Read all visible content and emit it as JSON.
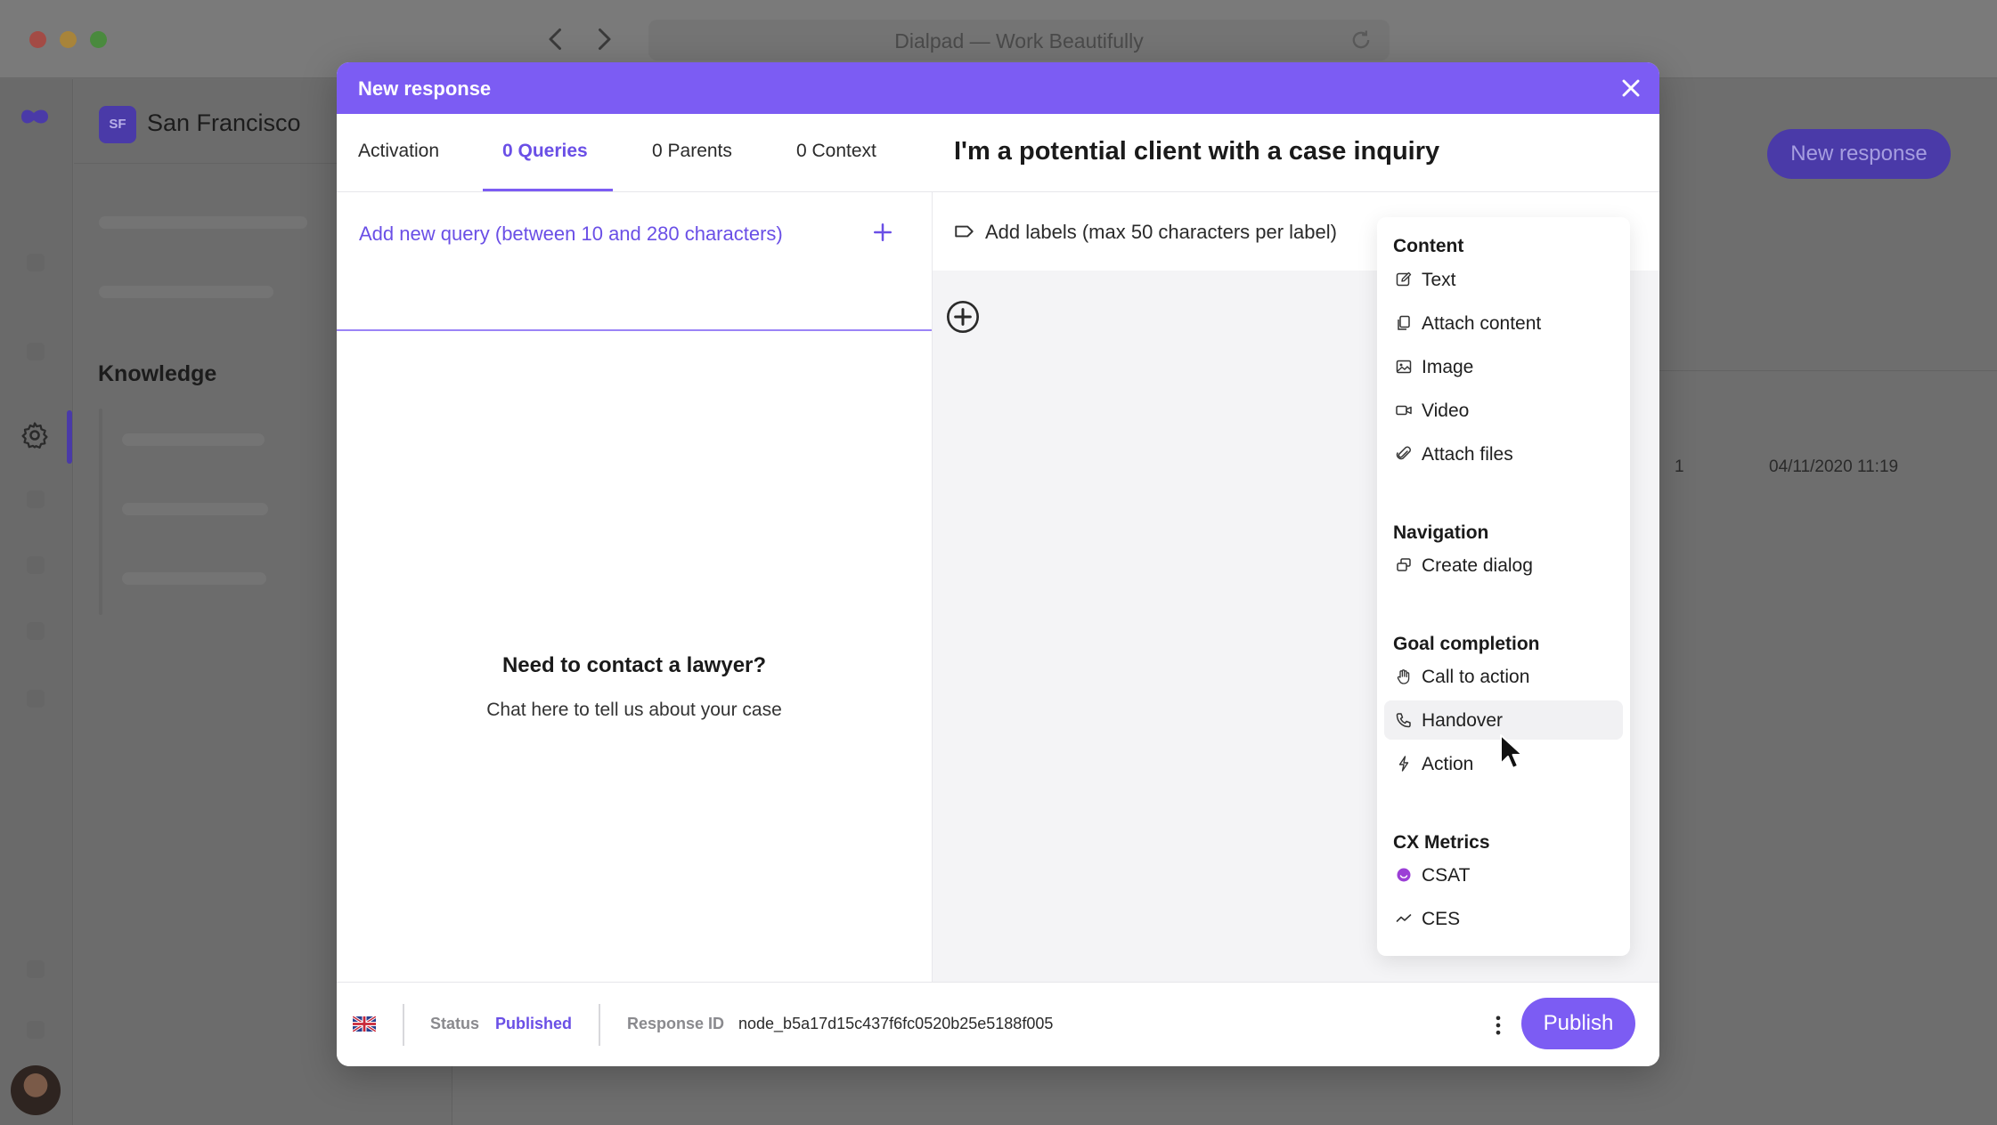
{
  "browser": {
    "title": "Dialpad — Work Beautifully",
    "back_icon": "chevron-left-icon",
    "forward_icon": "chevron-right-icon",
    "reload_icon": "reload-icon"
  },
  "app": {
    "workspace_badge": "SF",
    "workspace_name": "San Francisco",
    "section_heading": "Knowledge",
    "new_response_button": "New response",
    "table_row": {
      "count": "1",
      "date": "04/11/2020 11:19"
    }
  },
  "modal": {
    "title": "New response",
    "tabs": [
      {
        "label": "Activation",
        "active": false
      },
      {
        "label": "0 Queries",
        "active": true
      },
      {
        "label": "0 Parents",
        "active": false
      },
      {
        "label": "0 Context",
        "active": false
      }
    ],
    "response_title": "I'm a potential client with a case inquiry",
    "query_placeholder": "Add new query (between 10 and 280 characters)",
    "labels_placeholder": "Add labels (max 50 characters per label)",
    "empty_state": {
      "title": "Need to contact a lawyer?",
      "subtitle": "Chat here to tell us about your case"
    },
    "dropdown": {
      "sections": [
        {
          "title": "Content",
          "items": [
            {
              "label": "Text",
              "icon": "edit-icon"
            },
            {
              "label": "Attach content",
              "icon": "copy-icon"
            },
            {
              "label": "Image",
              "icon": "image-icon"
            },
            {
              "label": "Video",
              "icon": "video-icon"
            },
            {
              "label": "Attach files",
              "icon": "paperclip-icon"
            }
          ]
        },
        {
          "title": "Navigation",
          "items": [
            {
              "label": "Create dialog",
              "icon": "dialog-icon"
            }
          ]
        },
        {
          "title": "Goal completion",
          "items": [
            {
              "label": "Call to action",
              "icon": "hand-icon"
            },
            {
              "label": "Handover",
              "icon": "phone-icon",
              "hovered": true
            },
            {
              "label": "Action",
              "icon": "bolt-icon"
            }
          ]
        },
        {
          "title": "CX Metrics",
          "items": [
            {
              "label": "CSAT",
              "icon": "csat-icon"
            },
            {
              "label": "CES",
              "icon": "trend-icon"
            }
          ]
        }
      ]
    },
    "footer": {
      "language_icon": "uk-flag-icon",
      "status_label": "Status",
      "status_value": "Published",
      "response_id_label": "Response ID",
      "response_id_value": "node_b5a17d15c437f6fc0520b25e5188f005",
      "publish_button": "Publish"
    }
  },
  "colors": {
    "accent": "#7c5cf3",
    "accent_text": "#6a4fe6",
    "overlay_bg": "#6e6e6e",
    "csat": "#9b3fd6"
  }
}
